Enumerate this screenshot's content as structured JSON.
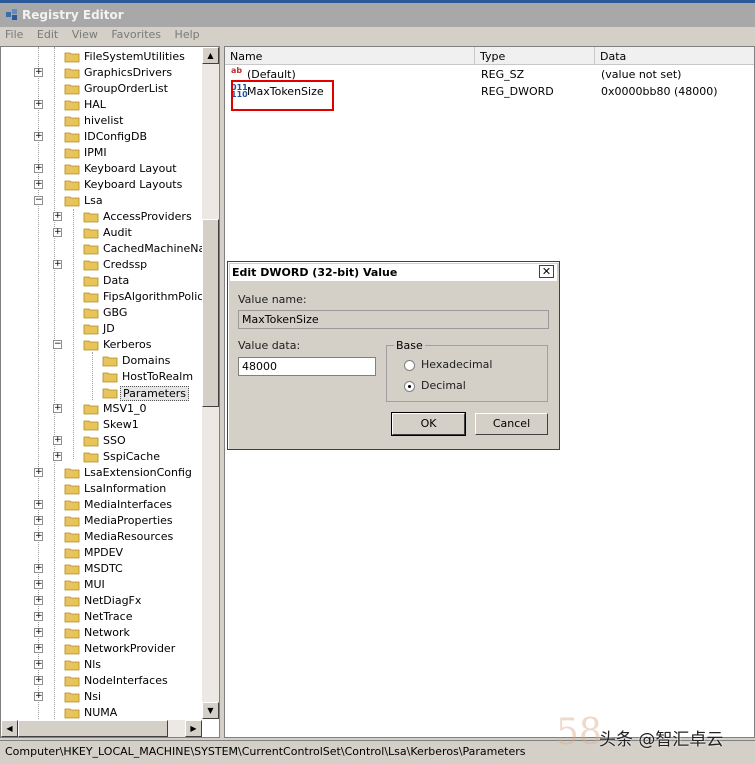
{
  "window": {
    "title": "Registry Editor"
  },
  "menu": [
    "File",
    "Edit",
    "View",
    "Favorites",
    "Help"
  ],
  "tree": {
    "items": [
      {
        "label": "FileSystemUtilities",
        "level": 0,
        "exp": ""
      },
      {
        "label": "GraphicsDrivers",
        "level": 0,
        "exp": "+"
      },
      {
        "label": "GroupOrderList",
        "level": 0,
        "exp": ""
      },
      {
        "label": "HAL",
        "level": 0,
        "exp": "+"
      },
      {
        "label": "hivelist",
        "level": 0,
        "exp": ""
      },
      {
        "label": "IDConfigDB",
        "level": 0,
        "exp": "+"
      },
      {
        "label": "IPMI",
        "level": 0,
        "exp": ""
      },
      {
        "label": "Keyboard Layout",
        "level": 0,
        "exp": "+"
      },
      {
        "label": "Keyboard Layouts",
        "level": 0,
        "exp": "+"
      },
      {
        "label": "Lsa",
        "level": 0,
        "exp": "-"
      },
      {
        "label": "AccessProviders",
        "level": 1,
        "exp": "+"
      },
      {
        "label": "Audit",
        "level": 1,
        "exp": "+"
      },
      {
        "label": "CachedMachineNam",
        "level": 1,
        "exp": ""
      },
      {
        "label": "Credssp",
        "level": 1,
        "exp": "+"
      },
      {
        "label": "Data",
        "level": 1,
        "exp": ""
      },
      {
        "label": "FipsAlgorithmPolicy",
        "level": 1,
        "exp": ""
      },
      {
        "label": "GBG",
        "level": 1,
        "exp": ""
      },
      {
        "label": "JD",
        "level": 1,
        "exp": ""
      },
      {
        "label": "Kerberos",
        "level": 1,
        "exp": "-"
      },
      {
        "label": "Domains",
        "level": 2,
        "exp": ""
      },
      {
        "label": "HostToRealm",
        "level": 2,
        "exp": ""
      },
      {
        "label": "Parameters",
        "level": 2,
        "exp": "",
        "selected": true
      },
      {
        "label": "MSV1_0",
        "level": 1,
        "exp": "+"
      },
      {
        "label": "Skew1",
        "level": 1,
        "exp": ""
      },
      {
        "label": "SSO",
        "level": 1,
        "exp": "+"
      },
      {
        "label": "SspiCache",
        "level": 1,
        "exp": "+"
      },
      {
        "label": "LsaExtensionConfig",
        "level": 0,
        "exp": "+"
      },
      {
        "label": "LsaInformation",
        "level": 0,
        "exp": ""
      },
      {
        "label": "MediaInterfaces",
        "level": 0,
        "exp": "+"
      },
      {
        "label": "MediaProperties",
        "level": 0,
        "exp": "+"
      },
      {
        "label": "MediaResources",
        "level": 0,
        "exp": "+"
      },
      {
        "label": "MPDEV",
        "level": 0,
        "exp": ""
      },
      {
        "label": "MSDTC",
        "level": 0,
        "exp": "+"
      },
      {
        "label": "MUI",
        "level": 0,
        "exp": "+"
      },
      {
        "label": "NetDiagFx",
        "level": 0,
        "exp": "+"
      },
      {
        "label": "NetTrace",
        "level": 0,
        "exp": "+"
      },
      {
        "label": "Network",
        "level": 0,
        "exp": "+"
      },
      {
        "label": "NetworkProvider",
        "level": 0,
        "exp": "+"
      },
      {
        "label": "Nls",
        "level": 0,
        "exp": "+"
      },
      {
        "label": "NodeInterfaces",
        "level": 0,
        "exp": "+"
      },
      {
        "label": "Nsi",
        "level": 0,
        "exp": "+"
      },
      {
        "label": "NUMA",
        "level": 0,
        "exp": ""
      }
    ]
  },
  "list": {
    "columns": [
      "Name",
      "Type",
      "Data"
    ],
    "rows": [
      {
        "icon": "string-value-icon",
        "name": "(Default)",
        "type": "REG_SZ",
        "data": "(value not set)"
      },
      {
        "icon": "dword-value-icon",
        "name": "MaxTokenSize",
        "type": "REG_DWORD",
        "data": "0x0000bb80 (48000)"
      }
    ]
  },
  "dialog": {
    "title": "Edit DWORD (32-bit) Value",
    "close": "✕",
    "value_name_label": "Value name:",
    "value_name": "MaxTokenSize",
    "value_data_label": "Value data:",
    "value_data": "48000",
    "base_label": "Base",
    "hex_label": "Hexadecimal",
    "dec_label": "Decimal",
    "selected_base": "Decimal",
    "ok": "OK",
    "cancel": "Cancel"
  },
  "statusbar": {
    "path": "Computer\\HKEY_LOCAL_MACHINE\\SYSTEM\\CurrentControlSet\\Control\\Lsa\\Kerberos\\Parameters"
  },
  "watermark": {
    "logo": "58",
    "text": "头条 @智汇卓云"
  },
  "colors": {
    "highlight": "#e00000",
    "folder": "#e8c45a"
  }
}
